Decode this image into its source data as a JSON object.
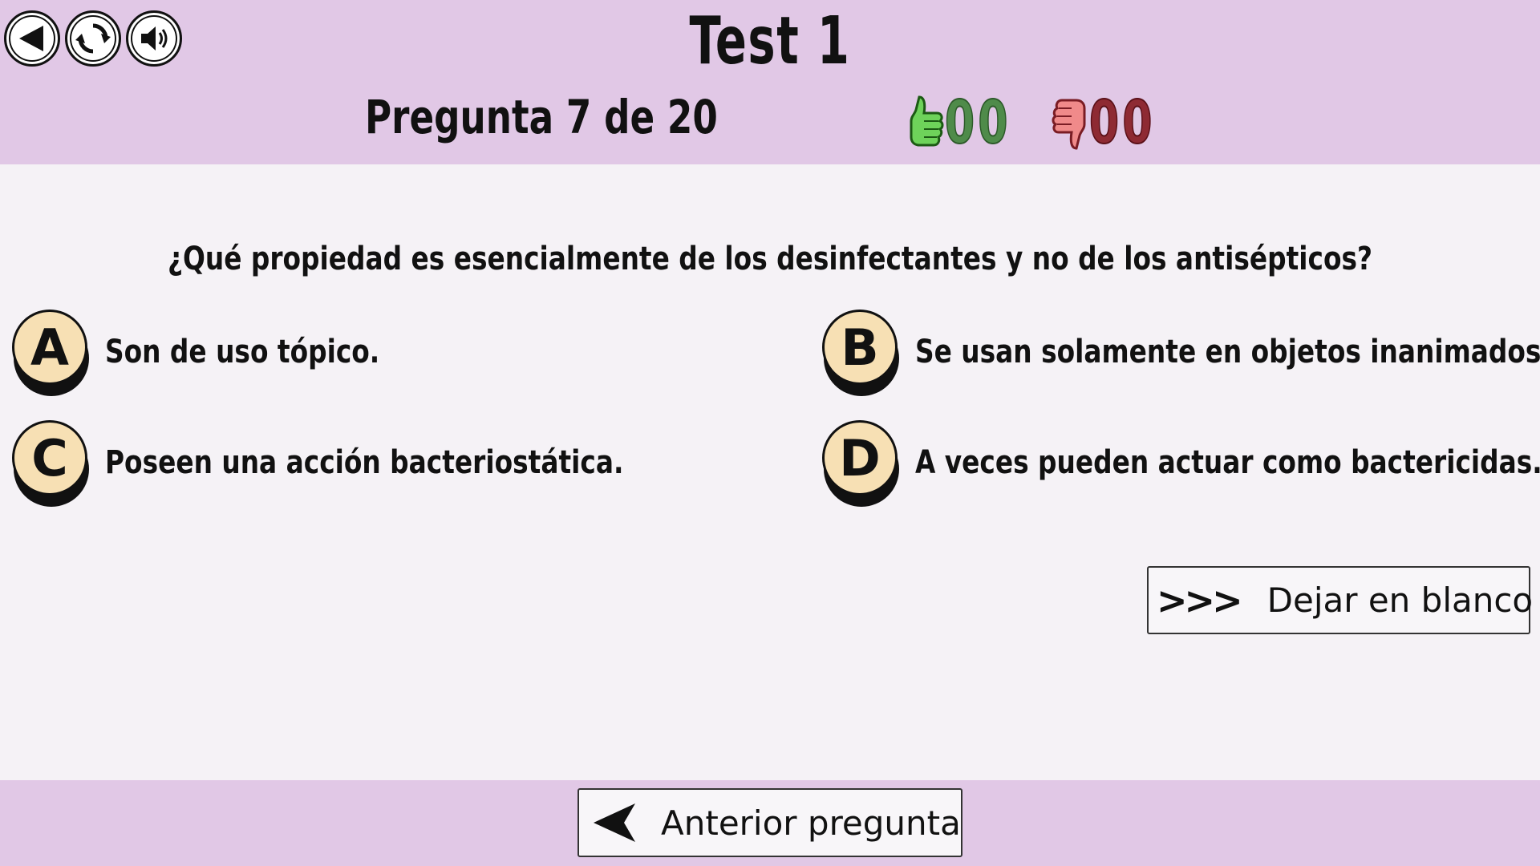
{
  "header": {
    "title": "Test 1",
    "question_counter": "Pregunta 7 de 20",
    "correct_count": "00",
    "wrong_count": "00",
    "back_icon": "back-arrow-icon",
    "reload_icon": "reload-icon",
    "sound_icon": "speaker-icon"
  },
  "question": {
    "text": "¿Qué propiedad es esencialmente de los desinfectantes y no de los antisépticos?"
  },
  "options": [
    {
      "letter": "A",
      "text": "Son de uso tópico."
    },
    {
      "letter": "B",
      "text": "Se usan solamente en objetos inanimados."
    },
    {
      "letter": "C",
      "text": "Poseen una acción bacteriostática."
    },
    {
      "letter": "D",
      "text": "A veces pueden actuar como bactericidas."
    }
  ],
  "skip_button": {
    "arrows": ">>>",
    "label": "Dejar en blanco"
  },
  "footer": {
    "prev_label": "Anterior pregunta"
  },
  "colors": {
    "header_bg": "#e1c8e6",
    "page_bg": "#f5f2f6",
    "badge_bg": "#f7e0b4",
    "correct": "#4f8b4a",
    "wrong": "#8e2a33"
  }
}
